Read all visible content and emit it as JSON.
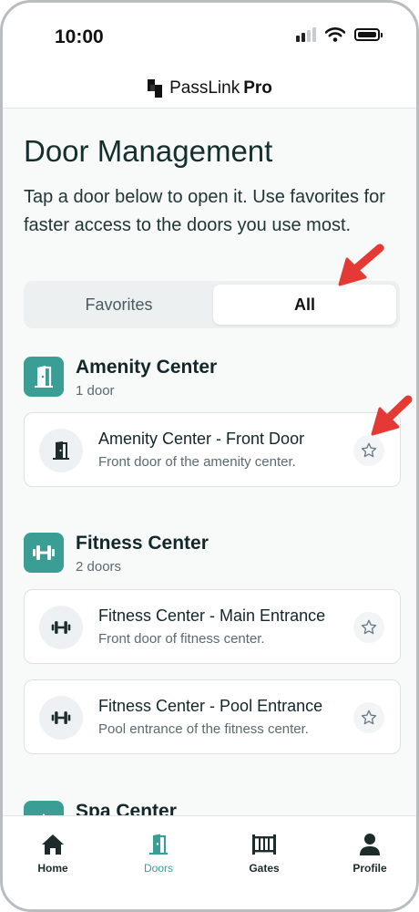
{
  "status_bar": {
    "time": "10:00"
  },
  "app": {
    "brand_name": "PassLink",
    "brand_suffix": "Pro"
  },
  "page": {
    "title": "Door Management",
    "subtitle": "Tap a door below to open it. Use favorites for faster access to the doors you use most."
  },
  "tabs": [
    {
      "label": "Favorites",
      "selected": false
    },
    {
      "label": "All",
      "selected": true
    }
  ],
  "groups": [
    {
      "name": "Amenity Center",
      "count": "1 door",
      "doors": [
        {
          "name": "Amenity Center - Front Door",
          "description": "Front door of the amenity center."
        }
      ]
    },
    {
      "name": "Fitness Center",
      "count": "2 doors",
      "doors": [
        {
          "name": "Fitness Center - Main Entrance",
          "description": "Front door of fitness center."
        },
        {
          "name": "Fitness Center - Pool Entrance",
          "description": "Pool entrance of the fitness center."
        }
      ]
    },
    {
      "name": "Spa Center"
    }
  ],
  "bottom_nav": [
    {
      "label": "Home",
      "icon": "home-icon"
    },
    {
      "label": "Doors",
      "icon": "door-icon",
      "active": true
    },
    {
      "label": "Gates",
      "icon": "gate-icon"
    },
    {
      "label": "Profile",
      "icon": "person-icon"
    }
  ],
  "colors": {
    "accent": "#3a9e94",
    "annotation_arrow": "#e53935"
  }
}
